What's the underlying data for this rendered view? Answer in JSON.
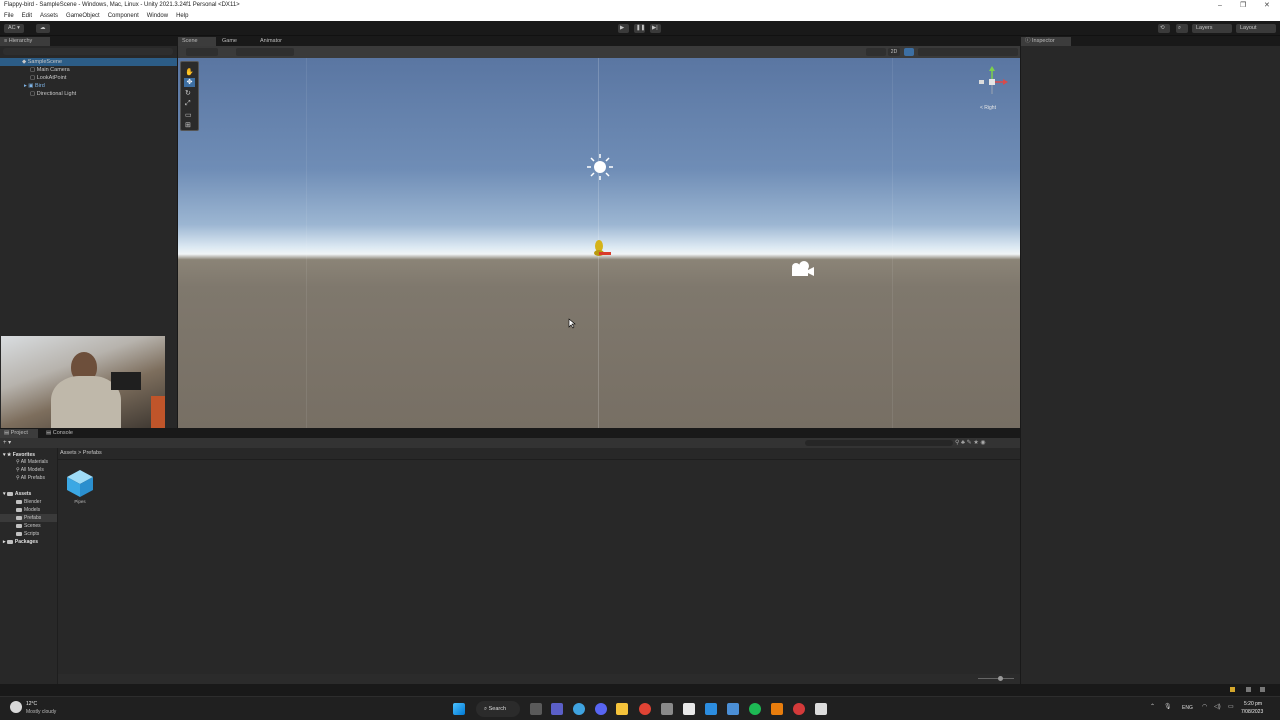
{
  "window": {
    "title": "Flappy-bird - SampleScene - Windows, Mac, Linux - Unity 2021.3.24f1 Personal <DX11>",
    "controls": [
      "–",
      "❐",
      "✕"
    ]
  },
  "menu": [
    "File",
    "Edit",
    "Assets",
    "GameObject",
    "Component",
    "Window",
    "Help"
  ],
  "toolbar": {
    "account": "AC ▾",
    "layers": "Layers",
    "layout": "Layout"
  },
  "hierarchy": {
    "tab": "Hierarchy",
    "scene": "SampleScene",
    "items": [
      "Main Camera",
      "LookAtPoint",
      "Bird",
      "Directional Light"
    ]
  },
  "scene": {
    "tabs": [
      "Scene",
      "Game",
      "Animator"
    ],
    "gizmo_label": "< Right",
    "toggle_2d": "2D"
  },
  "inspector": {
    "tab": "Inspector"
  },
  "project": {
    "tabs": [
      "Project",
      "Console"
    ],
    "favorites_label": "Favorites",
    "favorites": [
      "All Materials",
      "All Models",
      "All Prefabs"
    ],
    "assets_label": "Assets",
    "asset_folders": [
      "Blender",
      "Models",
      "Prefabs",
      "Scenes",
      "Scripts"
    ],
    "packages_label": "Packages",
    "breadcrumb": [
      "Assets",
      ">",
      "Prefabs"
    ],
    "files": [
      {
        "name": "Pipes"
      }
    ]
  },
  "taskbar": {
    "weather_temp": "12°C",
    "weather_desc": "Mostly cloudy",
    "search_label": "Search",
    "lang": "ENG",
    "time": "5:20 pm",
    "date": "7/08/2023"
  }
}
